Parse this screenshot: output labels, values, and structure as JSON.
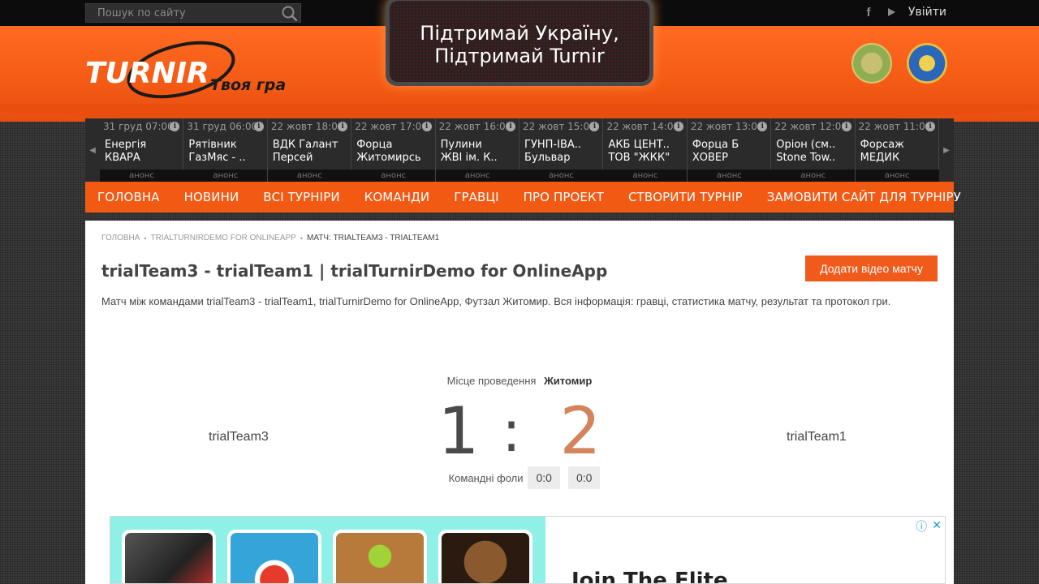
{
  "search": {
    "placeholder": "Пошук по сайту"
  },
  "top_links": {
    "login": "Увійти",
    "social_icons": [
      "facebook-icon",
      "youtube-icon"
    ]
  },
  "header": {
    "slogan": "Твоя гра",
    "banner_lines": [
      "Підтримай Україну,",
      "Підтримай Turnir"
    ]
  },
  "ticker": {
    "tag": "анонс",
    "matches": [
      {
        "date": "31 груд 07:00",
        "team1": "Енергія",
        "team2": "КВАРА"
      },
      {
        "date": "31 груд 06:00",
        "team1": "Рятівник",
        "team2": "ГазМяс - .."
      },
      {
        "date": "22 жовт 18:00",
        "team1": "ВДК Галант",
        "team2": "Персей"
      },
      {
        "date": "22 жовт 17:00",
        "team1": "Форца",
        "team2": "Житомирсь"
      },
      {
        "date": "22 жовт 16:00",
        "team1": "Пулини",
        "team2": "ЖВІ ім. К.."
      },
      {
        "date": "22 жовт 15:00",
        "team1": "ГУНП-ІВА..",
        "team2": "Бульвар"
      },
      {
        "date": "22 жовт 14:00",
        "team1": "АКБ ЦЕНТ..",
        "team2": "ТОВ \"ЖКК\""
      },
      {
        "date": "22 жовт 13:00",
        "team1": "Форца Б",
        "team2": "ХОВЕР"
      },
      {
        "date": "22 жовт 12:00",
        "team1": "Оріон (см..",
        "team2": "Stone Tow.."
      },
      {
        "date": "22 жовт 11:00",
        "team1": "Форсаж",
        "team2": "МЕДИК"
      }
    ]
  },
  "nav": {
    "items": [
      "ГОЛОВНА",
      "НОВИНИ",
      "ВСІ ТУРНІРИ",
      "КОМАНДИ",
      "ГРАВЦІ",
      "ПРО ПРОЕКТ",
      "СТВОРИТИ ТУРНІР",
      "ЗАМОВИТИ САЙТ ДЛЯ ТУРНІРУ"
    ]
  },
  "breadcrumb": {
    "home": "ГОЛОВНА",
    "tournament": "TRIALTURNIRDEMO FOR ONLINEAPP",
    "current": "МАТЧ: TRIALTEAM3 - TRIALTEAM1"
  },
  "page": {
    "title": "trialTeam3 - trialTeam1 | trialTurnirDemo for OnlineApp",
    "add_video_label": "Додати відео матчу",
    "description": "Матч між командами trialTeam3 - trialTeam1, trialTurnirDemo for OnlineApp, Футзал Житомир. Вся інформація: гравці, статистика матчу, результат та протокол гри."
  },
  "match": {
    "venue_label": "Місце проведення",
    "venue_value": "Житомир",
    "home_team": "trialTeam3",
    "away_team": "trialTeam1",
    "home_score": "1",
    "separator": ":",
    "away_score": "2",
    "fouls_label": "Командні фоли",
    "home_fouls": "0:0",
    "away_fouls": "0:0"
  },
  "ad": {
    "title": "Join The Elite",
    "controls": [
      "ⓘ",
      "✕"
    ]
  },
  "colors": {
    "accent": "#f25a14",
    "away_score": "#d4845a",
    "ad_background": "#8ef0e6"
  }
}
